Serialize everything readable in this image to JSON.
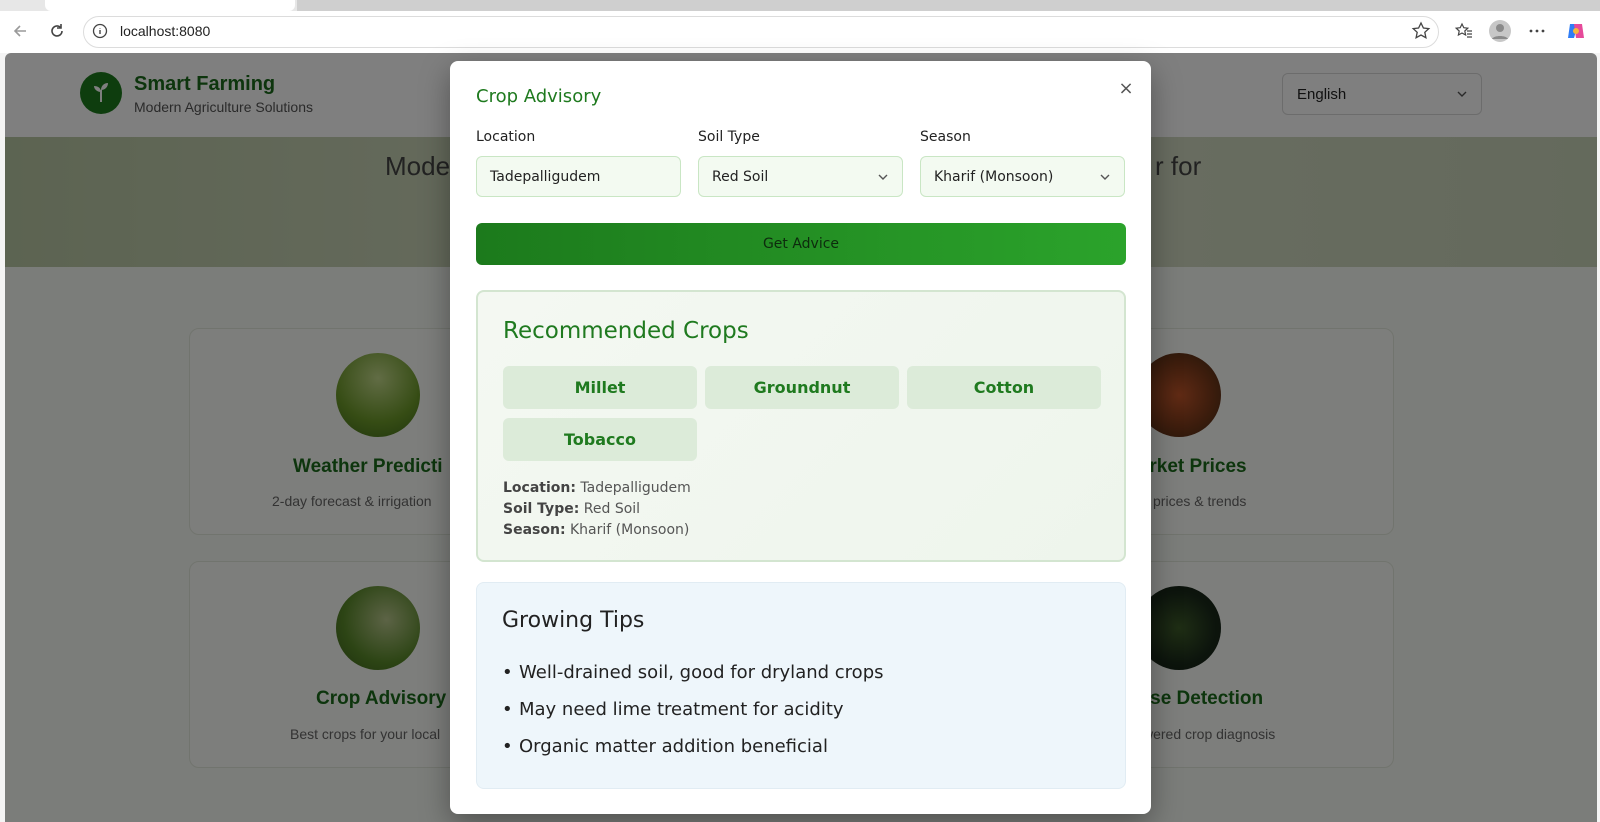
{
  "browser": {
    "url": "localhost:8080"
  },
  "header": {
    "brand_title": "Smart Farming",
    "brand_subtitle": "Modern Agriculture Solutions",
    "language": "English"
  },
  "hero": {
    "text_left": "Mode",
    "text_right": "r for"
  },
  "cards": [
    {
      "title": "Weather Predicti",
      "description": "2-day forecast & irrigation"
    },
    {
      "title": "Market Prices",
      "description": "rent prices & trends"
    },
    {
      "title": "Crop Advisory",
      "description": "Best crops for your local"
    },
    {
      "title": "ease Detection",
      "description": "wered crop diagnosis"
    }
  ],
  "modal": {
    "title": "Crop Advisory",
    "close_symbol": "×",
    "fields": {
      "location": {
        "label": "Location",
        "value": "Tadepalligudem"
      },
      "soil_type": {
        "label": "Soil Type",
        "value": "Red Soil"
      },
      "season": {
        "label": "Season",
        "value": "Kharif (Monsoon)"
      }
    },
    "get_advice_label": "Get Advice",
    "recommended": {
      "title": "Recommended Crops",
      "crops": [
        "Millet",
        "Groundnut",
        "Cotton",
        "Tobacco"
      ],
      "location_label": "Location:",
      "location_value": "Tadepalligudem",
      "soil_label": "Soil Type:",
      "soil_value": "Red Soil",
      "season_label": "Season:",
      "season_value": "Kharif (Monsoon)"
    },
    "tips": {
      "title": "Growing Tips",
      "items": [
        "Well-drained soil, good for dryland crops",
        "May need lime treatment for acidity",
        "Organic matter addition beneficial"
      ]
    }
  },
  "colors": {
    "brand_green": "#1f7a1f",
    "button_gradient_start": "#1c7a1c",
    "button_gradient_end": "#2ba32b",
    "tips_background": "#eef6fb"
  }
}
